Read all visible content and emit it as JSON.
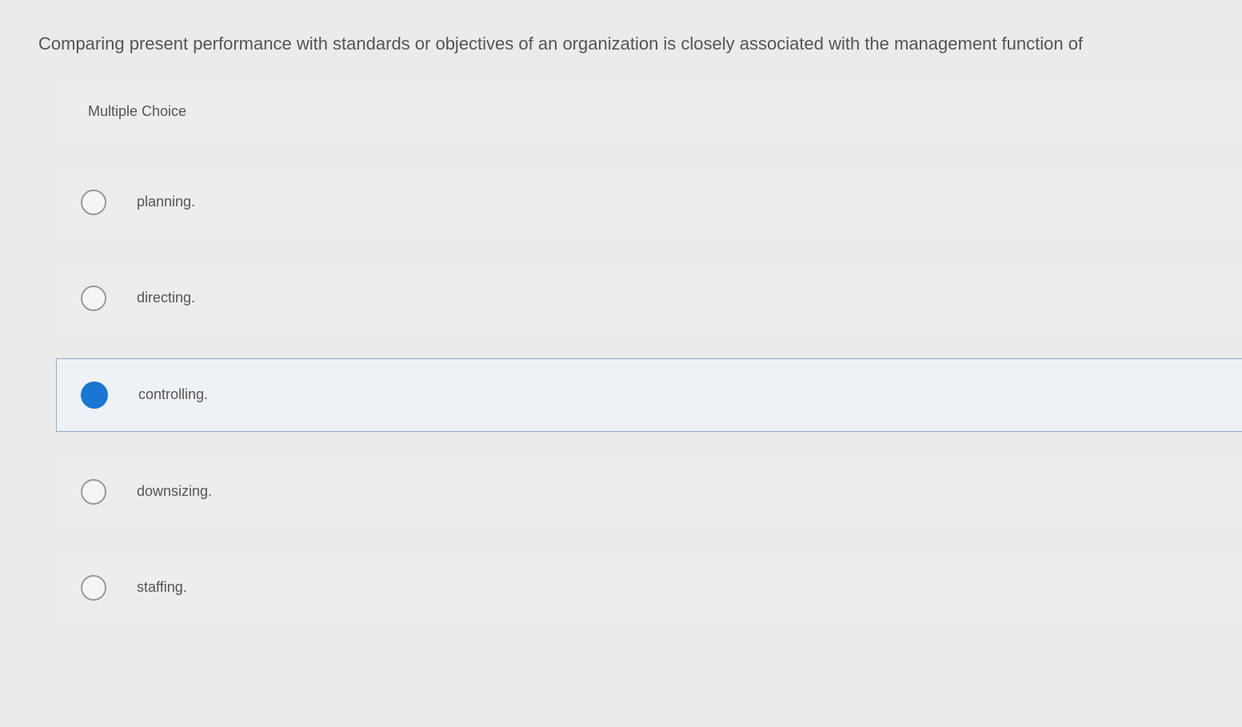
{
  "question": {
    "text": "Comparing present performance with standards or objectives of an organization is closely associated with the management function of"
  },
  "section_label": "Multiple Choice",
  "options": [
    {
      "label": "planning.",
      "selected": false
    },
    {
      "label": "directing.",
      "selected": false
    },
    {
      "label": "controlling.",
      "selected": true
    },
    {
      "label": "downsizing.",
      "selected": false
    },
    {
      "label": "staffing.",
      "selected": false
    }
  ]
}
